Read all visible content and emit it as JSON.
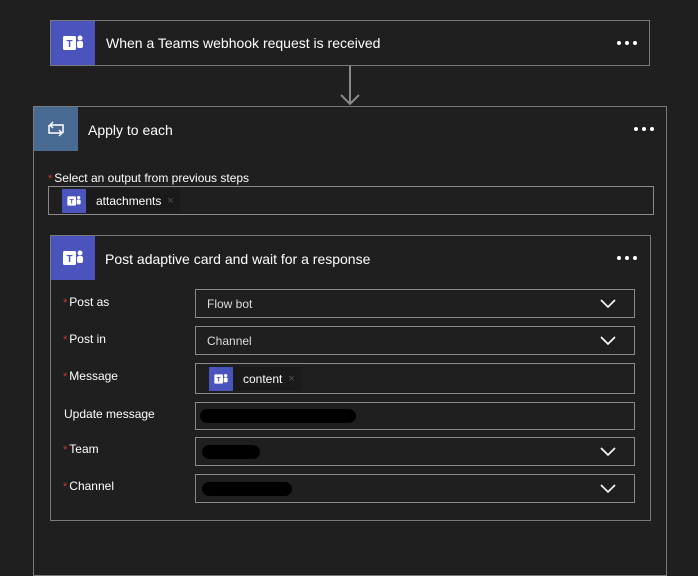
{
  "trigger": {
    "title": "When a Teams webhook request is received"
  },
  "loop": {
    "title": "Apply to each",
    "select_label": "Select an output from previous steps",
    "token": "attachments"
  },
  "action": {
    "title": "Post adaptive card and wait for a response",
    "fields": {
      "post_as": {
        "label": "Post as",
        "value": "Flow bot"
      },
      "post_in": {
        "label": "Post in",
        "value": "Channel"
      },
      "message": {
        "label": "Message",
        "token": "content"
      },
      "update_message": {
        "label": "Update message"
      },
      "team": {
        "label": "Team"
      },
      "channel": {
        "label": "Channel"
      }
    }
  },
  "required_mark": "*",
  "token_remove": "×",
  "colors": {
    "teams": "#4b53bc",
    "loop": "#486991",
    "required": "#d13438"
  }
}
